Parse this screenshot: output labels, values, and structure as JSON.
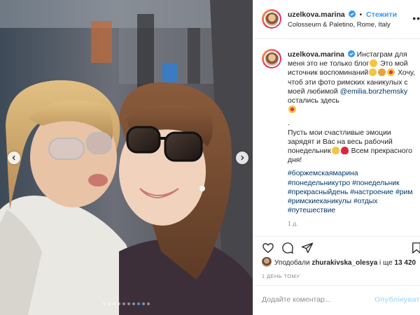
{
  "post": {
    "username": "uzelkova.marina",
    "follow_label": "Стежити",
    "separator": "•",
    "location": "Colosseum & Paletino, Rome, Italy",
    "verified_icon": "verified-badge-icon",
    "more_icon": "more-options-icon"
  },
  "caption": {
    "username": "uzelkova.marina",
    "line1_a": " Инстаграм для меня это не только блог",
    "line1_b": " Это мой источник воспоминаний",
    "line2_a": " Хочу, чтоб эти фото римских каникулых с моей любимой ",
    "mention": "@emilia.borzhemsky",
    "line2_b": " остались здесь",
    "dot": ".",
    "line3_a": "Пусть мои счастливые эмоции зарядят и Вас на весь рабочий понедельник",
    "line3_b": " Всем прекрасного дня!",
    "hashtags": [
      "#боржемскаямарина",
      "#понедельникутро",
      "#понедельник",
      "#прекрасныйдень",
      "#настроение",
      "#рим",
      "#римскиеканикулы",
      "#отдых",
      "#путешествие"
    ],
    "age": "1 д."
  },
  "likes": {
    "prefix": "Уподобали ",
    "user": "zhurakivska_olesya",
    "middle": " і ще ",
    "count": "13 420"
  },
  "timestamp": "1 ДЕНЬ ТОМУ",
  "comment": {
    "placeholder": "Додайте коментар...",
    "post_label": "Опублікувати"
  },
  "carousel": {
    "total_slides": 10,
    "active_index": 7
  },
  "colors": {
    "accent": "#3897f0",
    "link": "#00376b",
    "muted": "#8e8e8e",
    "post_disabled": "#b2dffc"
  }
}
